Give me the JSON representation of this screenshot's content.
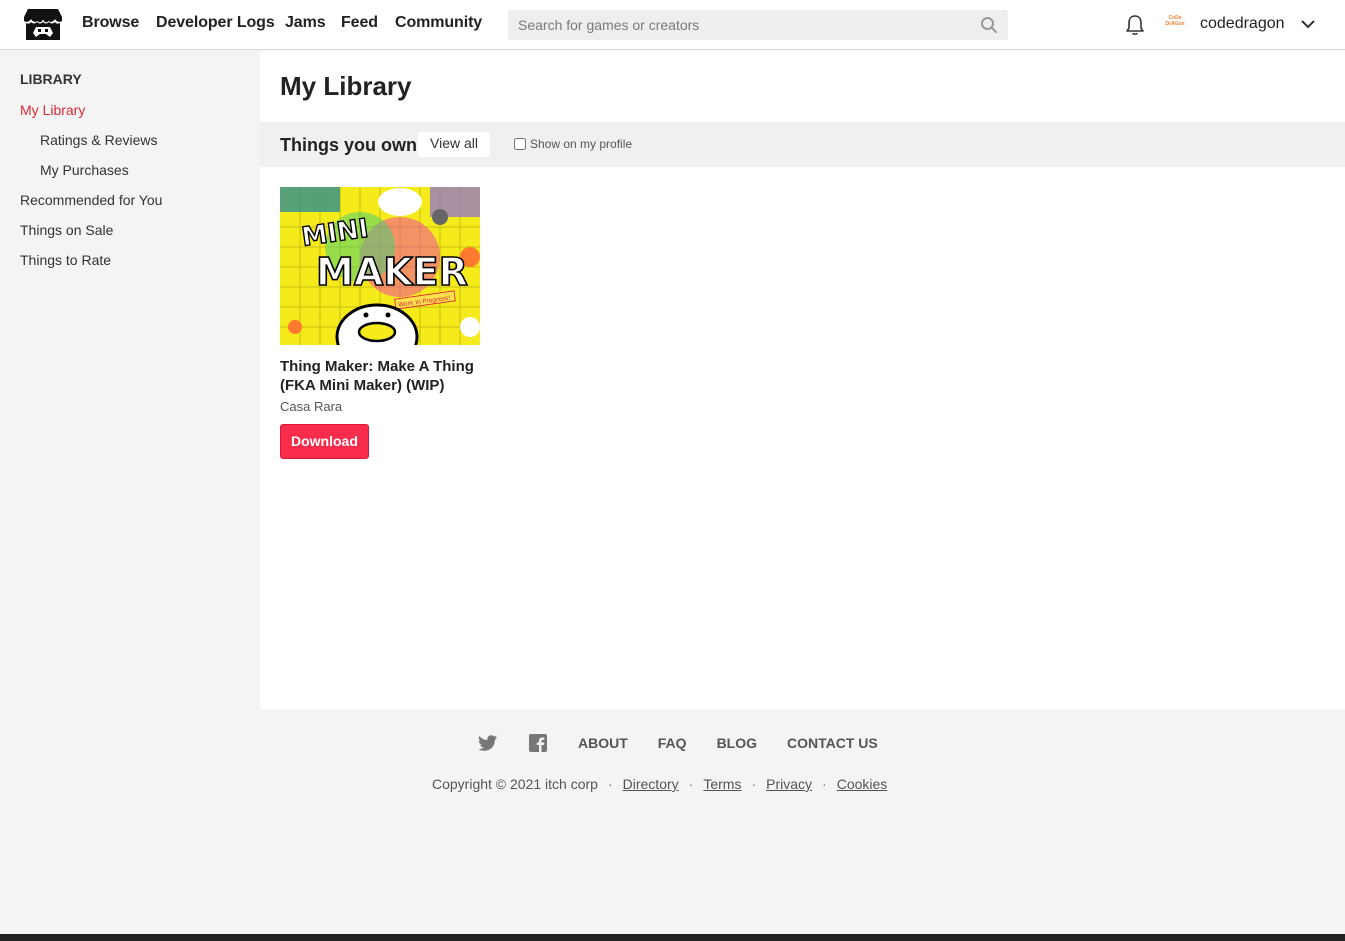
{
  "header": {
    "nav": [
      "Browse",
      "Developer Logs",
      "Jams",
      "Feed",
      "Community"
    ],
    "search_placeholder": "Search for games or creators",
    "username": "codedragon",
    "avatar_text": "CoDe DrAGon"
  },
  "sidebar": {
    "heading": "LIBRARY",
    "items": [
      {
        "label": "My Library",
        "active": true
      },
      {
        "label": "Ratings & Reviews",
        "sub": true
      },
      {
        "label": "My Purchases",
        "sub": true
      },
      {
        "label": "Recommended for You"
      },
      {
        "label": "Things on Sale"
      },
      {
        "label": "Things to Rate"
      }
    ]
  },
  "main": {
    "title": "My Library",
    "section_title": "Things you own",
    "view_all": "View all",
    "show_on_profile": "Show on my profile",
    "games": [
      {
        "title": "Thing Maker: Make A Thing (FKA Mini Maker) (WIP)",
        "author": "Casa Rara",
        "download_label": "Download",
        "thumb_text_1": "MINI",
        "thumb_text_2": "MAKER",
        "thumb_badge": "Work In Progress!"
      }
    ]
  },
  "footer": {
    "links": [
      "ABOUT",
      "FAQ",
      "BLOG",
      "CONTACT US"
    ],
    "copyright": "Copyright © 2021 itch corp",
    "legal": [
      "Directory",
      "Terms",
      "Privacy",
      "Cookies"
    ],
    "separator": "·"
  },
  "colors": {
    "accent": "#da2c38",
    "download": "#fa2c4c"
  }
}
